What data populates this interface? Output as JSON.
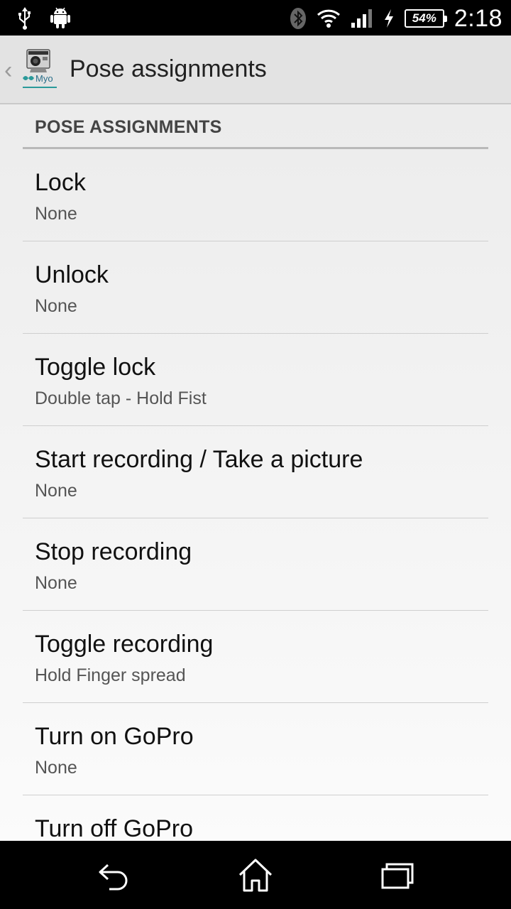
{
  "status_bar": {
    "time": "2:18",
    "battery": "54%",
    "icons": [
      "usb-icon",
      "android-icon",
      "bluetooth-icon",
      "wifi-icon",
      "signal-icon",
      "charging-icon",
      "battery-icon"
    ]
  },
  "action_bar": {
    "title": "Pose assignments",
    "app_icon": "myo-gopro-app-icon"
  },
  "section": {
    "title": "POSE ASSIGNMENTS"
  },
  "items": [
    {
      "title": "Lock",
      "summary": "None"
    },
    {
      "title": "Unlock",
      "summary": "None"
    },
    {
      "title": "Toggle lock",
      "summary": "Double tap - Hold Fist"
    },
    {
      "title": "Start recording / Take a picture",
      "summary": "None"
    },
    {
      "title": "Stop recording",
      "summary": "None"
    },
    {
      "title": "Toggle recording",
      "summary": "Hold Finger spread"
    },
    {
      "title": "Turn on GoPro",
      "summary": "None"
    },
    {
      "title": "Turn off GoPro",
      "summary": ""
    }
  ],
  "nav_bar": {
    "buttons": [
      "back-icon",
      "home-icon",
      "recent-apps-icon"
    ]
  }
}
